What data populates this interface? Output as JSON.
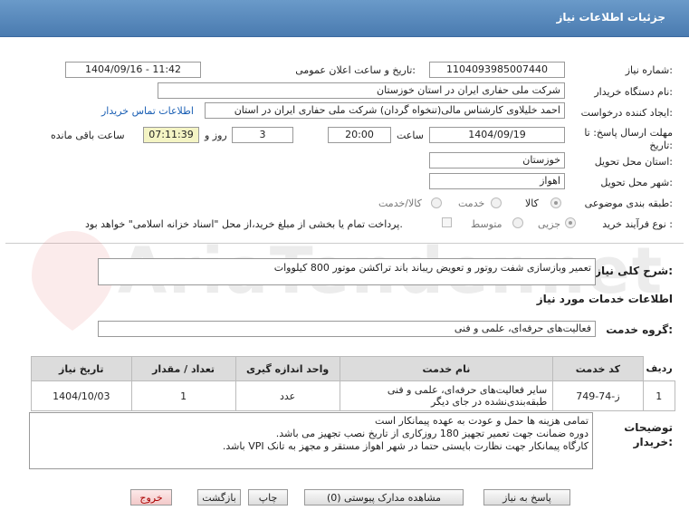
{
  "header": {
    "title": "جزئیات اطلاعات نیاز"
  },
  "fields": {
    "need_number_label": "شماره نیاز:",
    "need_number": "1104093985007440",
    "announce_label": "تاریخ و ساعت اعلان عمومی:",
    "announce_value": "1404/09/16 - 11:42",
    "buyer_label": "نام دستگاه خریدار:",
    "buyer_value": "شرکت ملی حفاری ایران در استان خوزستان",
    "creator_label": "ایجاد کننده درخواست:",
    "creator_value": "احمد خلیلاوی کارشناس مالی(تنخواه گردان) شرکت ملی حفاری ایران در استان",
    "contact_link": "اطلاعات تماس خریدار",
    "deadline_label": "مهلت ارسال پاسخ: تا تاریخ:",
    "deadline_date": "1404/09/19",
    "time_label": "ساعت",
    "deadline_time": "20:00",
    "days_value": "3",
    "days_label": "روز و",
    "remaining_time": "07:11:39",
    "remaining_label": "ساعت باقی مانده",
    "province_label": "استان محل تحویل:",
    "province_value": "خوزستان",
    "city_label": "شهر محل تحویل:",
    "city_value": "اهواز",
    "category_label": "طبقه بندی موضوعی:",
    "category_options": [
      "کالا",
      "خدمت",
      "کالا/خدمت"
    ],
    "category_selected": "خدمت",
    "process_label": "نوع فرآیند خرید :",
    "process_options": [
      "جزیی",
      "متوسط"
    ],
    "process_selected": "جزیی",
    "payment_note": "پرداخت تمام یا بخشی از مبلغ خرید،از محل \"اسناد خزانه اسلامی\" خواهد بود."
  },
  "summary": {
    "label": "شرح کلی نیاز:",
    "value": "تعمیر وبازسازی شفت روتور و تعویض ریباند باند تراکشن موتور 800 کیلووات"
  },
  "services": {
    "section_title": "اطلاعات خدمات مورد نیاز",
    "group_label": "گروه خدمت:",
    "group_value": "فعالیت‌های حرفه‌ای، علمی و فنی",
    "columns": [
      "ردیف",
      "کد خدمت",
      "نام خدمت",
      "واحد اندازه گیری",
      "تعداد / مقدار",
      "تاریخ نیاز"
    ],
    "rows": [
      {
        "index": "1",
        "code": "ز-74-749",
        "name": "سایر فعالیت‌های حرفه‌ای، علمی و فنی طبقه‌بندی‌نشده در جای دیگر",
        "unit": "عدد",
        "qty": "1",
        "date": "1404/10/03"
      }
    ]
  },
  "notes": {
    "label": "توضیحات خریدار:",
    "text": "تمامی هزینه ها حمل و عودت به عهده پیمانکار است\nدوره ضمانت جهت تعمیر تجهیز 180 روزکاری از تاریخ نصب تجهیز می باشد.\nکارگاه پیمانکار جهت نظارت بایستی حتما در شهر اهواز مستقر و مجهز به تانک VPI باشد."
  },
  "buttons": {
    "reply": "پاسخ به نیاز",
    "docs": "مشاهده مدارک پیوستی (0)",
    "print": "چاپ",
    "back": "بازگشت",
    "exit": "خروج"
  }
}
